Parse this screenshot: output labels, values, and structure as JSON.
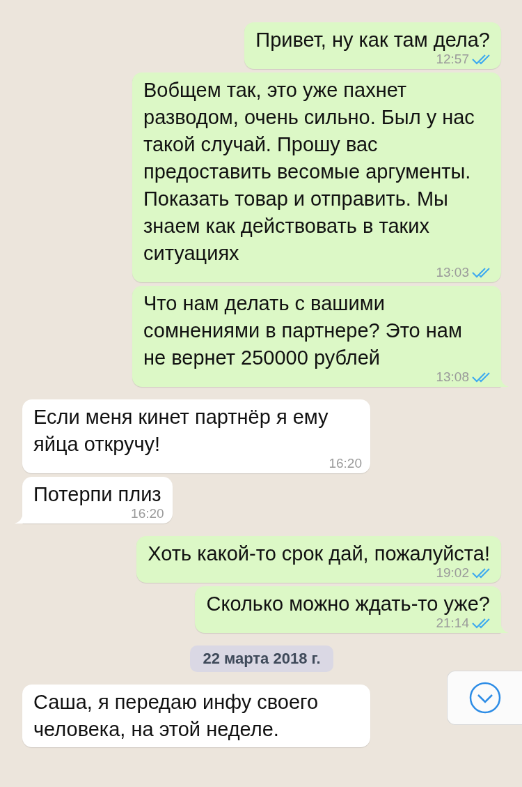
{
  "messages": [
    {
      "kind": "outgoing",
      "text": "Привет, ну как там дела?",
      "time": "12:57",
      "read": true,
      "tail": false
    },
    {
      "kind": "outgoing",
      "text": "Вобщем так, это уже пахнет разводом, очень сильно. Был у нас такой случай. Прошу вас предоставить весомые аргументы. Показать товар и отправить. Мы знаем как действовать в таких ситуациях",
      "time": "13:03",
      "read": true,
      "tail": false
    },
    {
      "kind": "outgoing",
      "text": "Что нам делать с вашими сомнениями в партнере? Это нам не вернет 250000 рублей",
      "time": "13:08",
      "read": true,
      "tail": true
    },
    {
      "kind": "incoming",
      "text": "Если меня кинет партнёр я ему яйца откручу!",
      "time": "16:20",
      "tail": false
    },
    {
      "kind": "incoming",
      "text": "Потерпи плиз",
      "time": "16:20",
      "tail": true
    },
    {
      "kind": "outgoing",
      "text": "Хоть какой-то срок дай, пожалуйста!",
      "time": "19:02",
      "read": true,
      "tail": false
    },
    {
      "kind": "outgoing",
      "text": "Сколько можно ждать-то уже?",
      "time": "21:14",
      "read": true,
      "tail": true
    },
    {
      "kind": "date",
      "text": "22 марта 2018 г."
    },
    {
      "kind": "incoming",
      "text": "Саша, я передаю инфу своего человека, на этой неделе.",
      "tail": false
    }
  ]
}
